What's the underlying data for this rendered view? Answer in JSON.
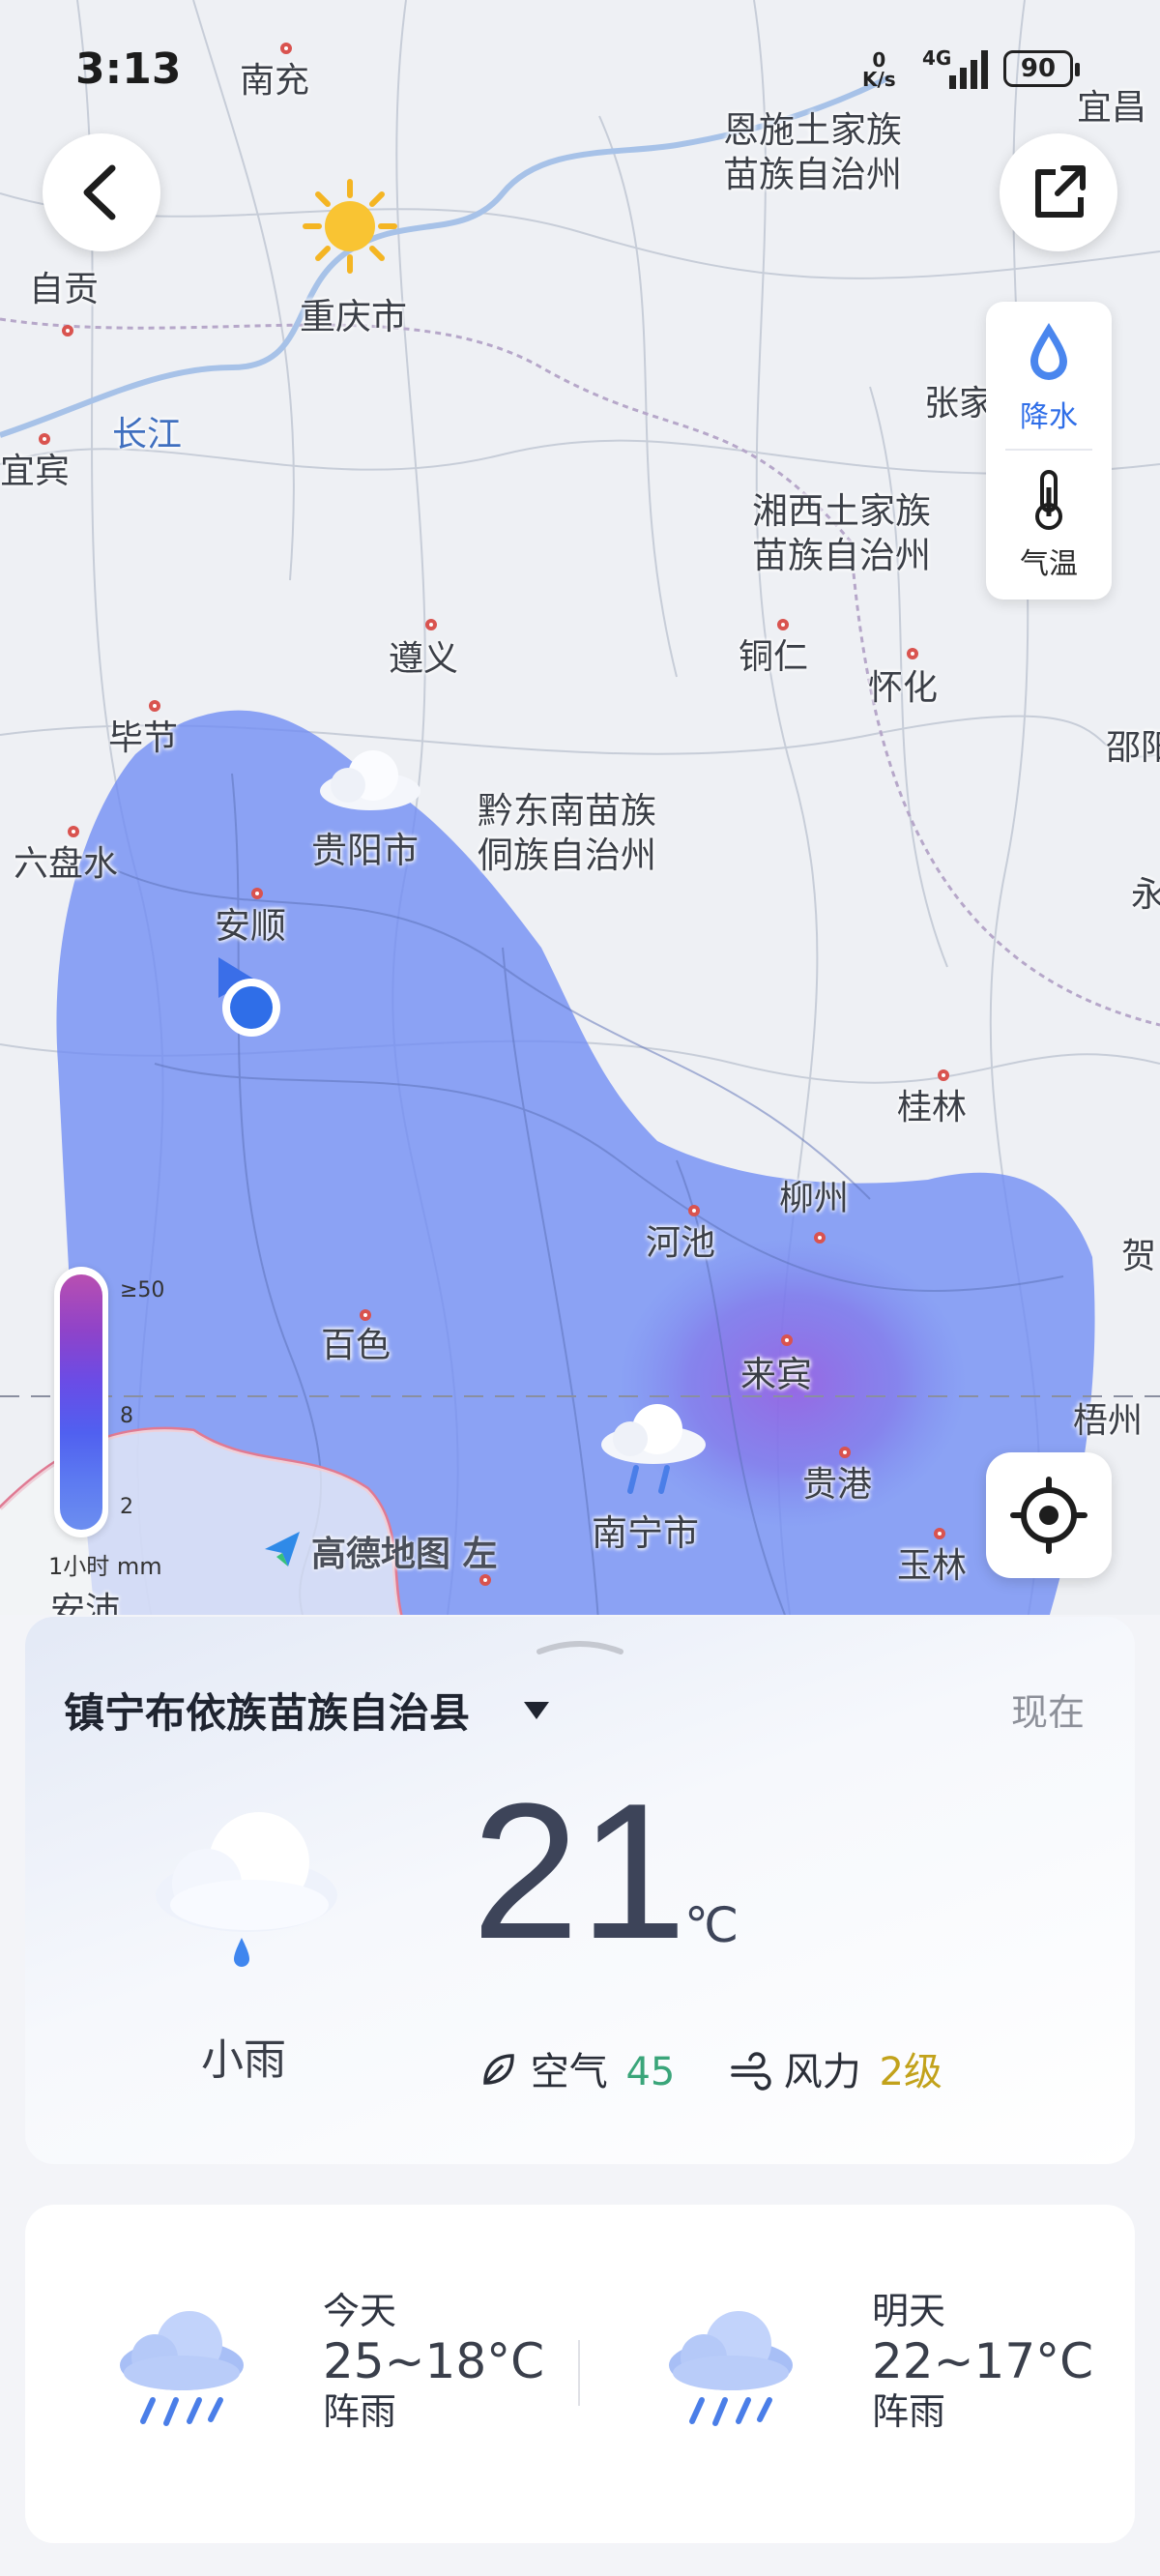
{
  "status_bar": {
    "time": "3:13",
    "net_speed_value": "0",
    "net_speed_unit": "K/s",
    "network": "4G",
    "battery": "90"
  },
  "map": {
    "cities": [
      {
        "name": "南充"
      },
      {
        "name": "恩施土家族\n苗族自治州"
      },
      {
        "name": "宜昌"
      },
      {
        "name": "重庆市"
      },
      {
        "name": "自贡"
      },
      {
        "name": "长江"
      },
      {
        "name": "宜宾"
      },
      {
        "name": "张家"
      },
      {
        "name": "湘西土家族\n苗族自治州"
      },
      {
        "name": "遵义"
      },
      {
        "name": "铜仁"
      },
      {
        "name": "怀化"
      },
      {
        "name": "毕节"
      },
      {
        "name": "邵阳"
      },
      {
        "name": "黔东南苗族\n侗族自治州"
      },
      {
        "name": "六盘水"
      },
      {
        "name": "贵阳市"
      },
      {
        "name": "安顺"
      },
      {
        "name": "永"
      },
      {
        "name": "桂林"
      },
      {
        "name": "柳州"
      },
      {
        "name": "河池"
      },
      {
        "name": "贺"
      },
      {
        "name": "百色"
      },
      {
        "name": "来宾"
      },
      {
        "name": "梧州"
      },
      {
        "name": "贵港"
      },
      {
        "name": "南宁市"
      },
      {
        "name": "玉林"
      },
      {
        "name": "安沛"
      }
    ],
    "layer_buttons": [
      {
        "label": "降水",
        "icon": "water-drop-icon",
        "active": true
      },
      {
        "label": "气温",
        "icon": "thermometer-icon",
        "active": false
      }
    ],
    "legend": {
      "max_label": "≥50",
      "mid_label": "8",
      "min_label": "2",
      "unit": "1小时 mm"
    },
    "watermark": "高德地图 左",
    "colors": {
      "rain_light": "#6f8cf4",
      "rain_heavy": "#8a6be6",
      "accent": "#2f6ee8"
    }
  },
  "current": {
    "location": "镇宁布依族苗族自治县",
    "time_label": "现在",
    "temperature": "21",
    "unit": "℃",
    "condition": "小雨",
    "air_label": "空气",
    "air_value": "45",
    "wind_label": "风力",
    "wind_value": "2级",
    "colors": {
      "air": "#3aa57a",
      "wind": "#c2a21b"
    }
  },
  "forecast": [
    {
      "day": "今天",
      "temp": "25~18°C",
      "condition": "阵雨",
      "icon": "rain-cloud-icon"
    },
    {
      "day": "明天",
      "temp": "22~17°C",
      "condition": "阵雨",
      "icon": "rain-cloud-icon"
    }
  ]
}
